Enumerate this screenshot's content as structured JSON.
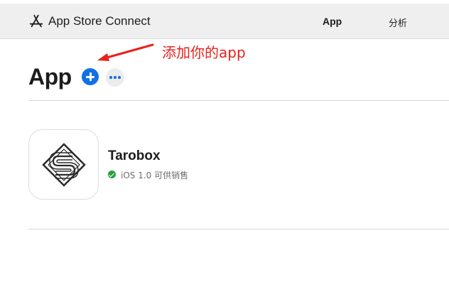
{
  "header": {
    "brand": "App Store Connect",
    "nav": [
      {
        "label": "App"
      },
      {
        "label": "分析"
      }
    ]
  },
  "page": {
    "title": "App"
  },
  "annotation": {
    "text": "添加你的app",
    "color": "#e8221b"
  },
  "apps": [
    {
      "name": "Tarobox",
      "status": "iOS 1.0 可供销售",
      "status_color": "#26a13a",
      "icon": "tarobox-logo"
    }
  ],
  "colors": {
    "accent": "#1071e5",
    "header_bg": "#efefef"
  }
}
